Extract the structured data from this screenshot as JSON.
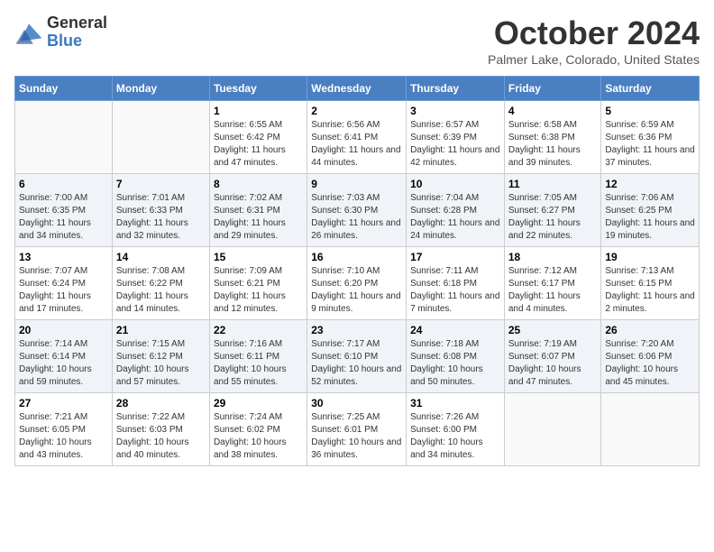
{
  "header": {
    "logo_general": "General",
    "logo_blue": "Blue",
    "month_title": "October 2024",
    "location": "Palmer Lake, Colorado, United States"
  },
  "days_of_week": [
    "Sunday",
    "Monday",
    "Tuesday",
    "Wednesday",
    "Thursday",
    "Friday",
    "Saturday"
  ],
  "weeks": [
    [
      {
        "day": "",
        "info": ""
      },
      {
        "day": "",
        "info": ""
      },
      {
        "day": "1",
        "info": "Sunrise: 6:55 AM\nSunset: 6:42 PM\nDaylight: 11 hours and 47 minutes."
      },
      {
        "day": "2",
        "info": "Sunrise: 6:56 AM\nSunset: 6:41 PM\nDaylight: 11 hours and 44 minutes."
      },
      {
        "day": "3",
        "info": "Sunrise: 6:57 AM\nSunset: 6:39 PM\nDaylight: 11 hours and 42 minutes."
      },
      {
        "day": "4",
        "info": "Sunrise: 6:58 AM\nSunset: 6:38 PM\nDaylight: 11 hours and 39 minutes."
      },
      {
        "day": "5",
        "info": "Sunrise: 6:59 AM\nSunset: 6:36 PM\nDaylight: 11 hours and 37 minutes."
      }
    ],
    [
      {
        "day": "6",
        "info": "Sunrise: 7:00 AM\nSunset: 6:35 PM\nDaylight: 11 hours and 34 minutes."
      },
      {
        "day": "7",
        "info": "Sunrise: 7:01 AM\nSunset: 6:33 PM\nDaylight: 11 hours and 32 minutes."
      },
      {
        "day": "8",
        "info": "Sunrise: 7:02 AM\nSunset: 6:31 PM\nDaylight: 11 hours and 29 minutes."
      },
      {
        "day": "9",
        "info": "Sunrise: 7:03 AM\nSunset: 6:30 PM\nDaylight: 11 hours and 26 minutes."
      },
      {
        "day": "10",
        "info": "Sunrise: 7:04 AM\nSunset: 6:28 PM\nDaylight: 11 hours and 24 minutes."
      },
      {
        "day": "11",
        "info": "Sunrise: 7:05 AM\nSunset: 6:27 PM\nDaylight: 11 hours and 22 minutes."
      },
      {
        "day": "12",
        "info": "Sunrise: 7:06 AM\nSunset: 6:25 PM\nDaylight: 11 hours and 19 minutes."
      }
    ],
    [
      {
        "day": "13",
        "info": "Sunrise: 7:07 AM\nSunset: 6:24 PM\nDaylight: 11 hours and 17 minutes."
      },
      {
        "day": "14",
        "info": "Sunrise: 7:08 AM\nSunset: 6:22 PM\nDaylight: 11 hours and 14 minutes."
      },
      {
        "day": "15",
        "info": "Sunrise: 7:09 AM\nSunset: 6:21 PM\nDaylight: 11 hours and 12 minutes."
      },
      {
        "day": "16",
        "info": "Sunrise: 7:10 AM\nSunset: 6:20 PM\nDaylight: 11 hours and 9 minutes."
      },
      {
        "day": "17",
        "info": "Sunrise: 7:11 AM\nSunset: 6:18 PM\nDaylight: 11 hours and 7 minutes."
      },
      {
        "day": "18",
        "info": "Sunrise: 7:12 AM\nSunset: 6:17 PM\nDaylight: 11 hours and 4 minutes."
      },
      {
        "day": "19",
        "info": "Sunrise: 7:13 AM\nSunset: 6:15 PM\nDaylight: 11 hours and 2 minutes."
      }
    ],
    [
      {
        "day": "20",
        "info": "Sunrise: 7:14 AM\nSunset: 6:14 PM\nDaylight: 10 hours and 59 minutes."
      },
      {
        "day": "21",
        "info": "Sunrise: 7:15 AM\nSunset: 6:12 PM\nDaylight: 10 hours and 57 minutes."
      },
      {
        "day": "22",
        "info": "Sunrise: 7:16 AM\nSunset: 6:11 PM\nDaylight: 10 hours and 55 minutes."
      },
      {
        "day": "23",
        "info": "Sunrise: 7:17 AM\nSunset: 6:10 PM\nDaylight: 10 hours and 52 minutes."
      },
      {
        "day": "24",
        "info": "Sunrise: 7:18 AM\nSunset: 6:08 PM\nDaylight: 10 hours and 50 minutes."
      },
      {
        "day": "25",
        "info": "Sunrise: 7:19 AM\nSunset: 6:07 PM\nDaylight: 10 hours and 47 minutes."
      },
      {
        "day": "26",
        "info": "Sunrise: 7:20 AM\nSunset: 6:06 PM\nDaylight: 10 hours and 45 minutes."
      }
    ],
    [
      {
        "day": "27",
        "info": "Sunrise: 7:21 AM\nSunset: 6:05 PM\nDaylight: 10 hours and 43 minutes."
      },
      {
        "day": "28",
        "info": "Sunrise: 7:22 AM\nSunset: 6:03 PM\nDaylight: 10 hours and 40 minutes."
      },
      {
        "day": "29",
        "info": "Sunrise: 7:24 AM\nSunset: 6:02 PM\nDaylight: 10 hours and 38 minutes."
      },
      {
        "day": "30",
        "info": "Sunrise: 7:25 AM\nSunset: 6:01 PM\nDaylight: 10 hours and 36 minutes."
      },
      {
        "day": "31",
        "info": "Sunrise: 7:26 AM\nSunset: 6:00 PM\nDaylight: 10 hours and 34 minutes."
      },
      {
        "day": "",
        "info": ""
      },
      {
        "day": "",
        "info": ""
      }
    ]
  ]
}
